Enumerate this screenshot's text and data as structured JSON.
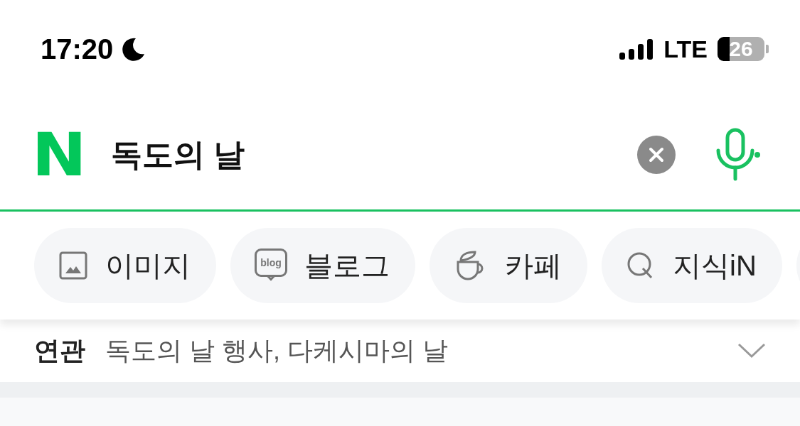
{
  "status_bar": {
    "time": "17:20",
    "network": "LTE",
    "battery": {
      "reading": "26",
      "level": 0.26
    }
  },
  "search": {
    "logo": "N",
    "value": "독도의 날"
  },
  "chips": [
    {
      "kind": "image",
      "label": "이미지"
    },
    {
      "kind": "blog",
      "label": "블로그",
      "icon_text": "blog"
    },
    {
      "kind": "cafe",
      "label": "카페"
    },
    {
      "kind": "kin",
      "label": "지식iN"
    }
  ],
  "related": {
    "label": "연관",
    "text": "독도의 날 행사, 다케시마의 날",
    "expanded": false
  }
}
